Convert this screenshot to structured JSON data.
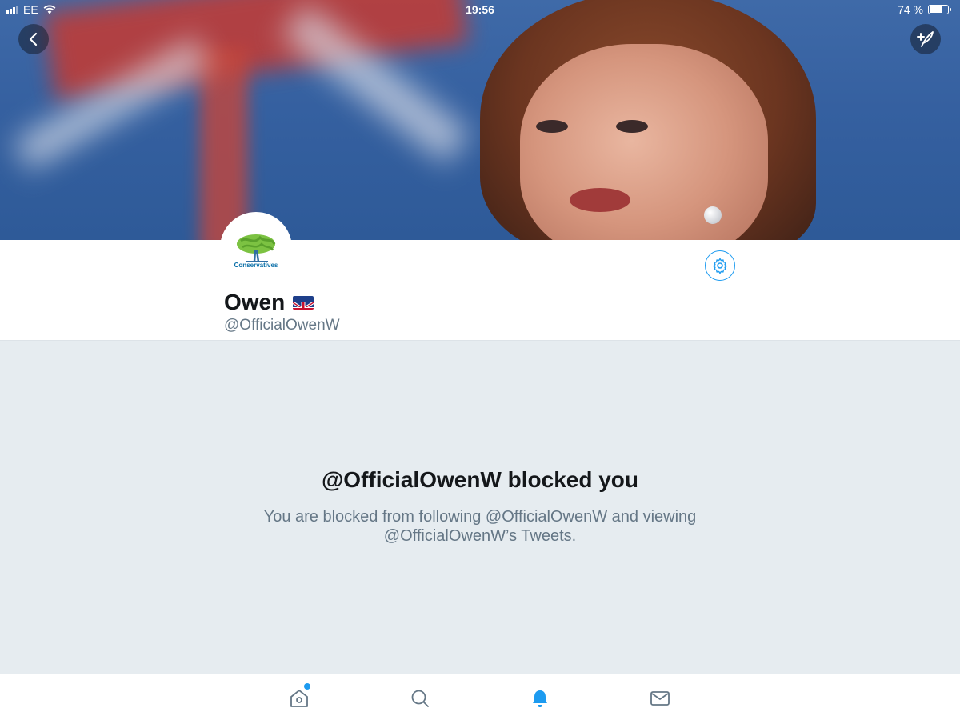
{
  "status_bar": {
    "carrier": "EE",
    "time": "19:56",
    "battery": "74 %",
    "battery_level": 0.74
  },
  "header": {
    "back_icon": "chevron-left-icon",
    "compose_icon": "compose-tweet-icon"
  },
  "profile": {
    "avatar_text": "Conservatives",
    "display_name": "Owen",
    "flag_icon": "uk-flag-icon",
    "handle": "@OfficialOwenW",
    "settings_icon": "gear-icon"
  },
  "blocked": {
    "title": "@OfficialOwenW blocked you",
    "line1": "You are blocked from following @OfficialOwenW and viewing",
    "line2": "@OfficialOwenW’s Tweets."
  },
  "tab_bar": {
    "items": [
      {
        "name": "home",
        "icon": "home-icon",
        "active": false,
        "badge": true
      },
      {
        "name": "search",
        "icon": "search-icon",
        "active": false,
        "badge": false
      },
      {
        "name": "notifications",
        "icon": "bell-icon",
        "active": true,
        "badge": false
      },
      {
        "name": "messages",
        "icon": "mail-icon",
        "active": false,
        "badge": false
      }
    ]
  },
  "colors": {
    "accent": "#1d9bf0",
    "background": "#e6ecf0",
    "text_secondary": "#657786",
    "text_primary": "#14171a"
  }
}
